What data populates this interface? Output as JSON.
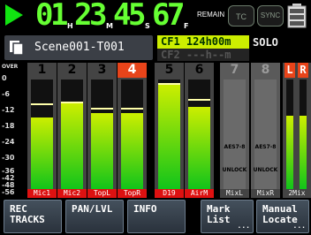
{
  "timecode": {
    "digits": [
      "0",
      "1",
      "2",
      "3",
      "4",
      "5",
      "6",
      "7"
    ],
    "unit_h": "H",
    "unit_m": "M",
    "unit_s": "S",
    "unit_f": "F",
    "remain_label": "REMAIN"
  },
  "status": {
    "tc_label": "TC",
    "sync_label": "SYNC"
  },
  "scene": {
    "name": "Scene001-T001"
  },
  "card": {
    "cf1": "CF1 124h00m",
    "cf2": "CF2 ---h--m"
  },
  "mode": "SOLO",
  "scale": {
    "labels": [
      "OVER",
      "0",
      "-6",
      "-12",
      "-18",
      "-24",
      "-30",
      "-36",
      "-42",
      "-48",
      "-56"
    ]
  },
  "channels": [
    {
      "num": "1",
      "label": "Mic1",
      "level": 0.65,
      "peak": 0.78,
      "rec": false,
      "label_color": "red"
    },
    {
      "num": "2",
      "label": "Mic2",
      "level": 0.78,
      "peak": 0.8,
      "rec": false,
      "label_color": "red"
    },
    {
      "num": "3",
      "label": "TopL",
      "level": 0.69,
      "peak": 0.74,
      "rec": false,
      "label_color": "red"
    },
    {
      "num": "4",
      "label": "TopR",
      "level": 0.69,
      "peak": 0.74,
      "rec": true,
      "label_color": "red"
    },
    {
      "num": "5",
      "label": "D19",
      "level": 0.95,
      "peak": 0.97,
      "rec": false,
      "label_color": "red"
    },
    {
      "num": "6",
      "label": "AirM",
      "level": 0.75,
      "peak": 0.82,
      "rec": false,
      "label_color": "red"
    }
  ],
  "aes_channels": [
    {
      "num": "7",
      "source": "AES7-8",
      "state": "UNLOCK",
      "label": "MixL"
    },
    {
      "num": "8",
      "source": "AES7-8",
      "state": "UNLOCK",
      "label": "MixR"
    }
  ],
  "mix": {
    "left_label": "L",
    "right_label": "R",
    "label": "2Mix"
  },
  "buttons": [
    {
      "label": "REC\nTRACKS",
      "dots": ""
    },
    {
      "label": "PAN/LVL",
      "dots": ""
    },
    {
      "label": "INFO",
      "dots": ""
    },
    {
      "label": "Mark\nList",
      "dots": "..."
    },
    {
      "label": "Manual\nLocate",
      "dots": "..."
    }
  ],
  "colors": {
    "play": "#11e411",
    "rec": "#e8441a",
    "meter_top": "#ccee00",
    "meter_bottom": "#11c41a",
    "card_active": "#ccee00"
  }
}
